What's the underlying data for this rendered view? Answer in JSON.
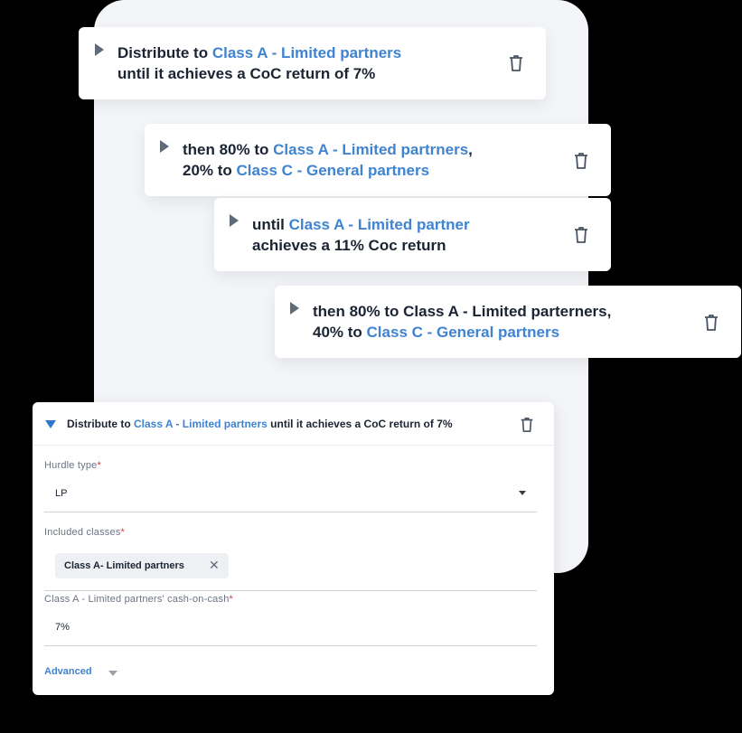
{
  "steps": [
    {
      "parts": [
        "Distribute to ",
        "Class A - Limited partners",
        "until it achieves a CoC return of 7%"
      ]
    },
    {
      "parts": [
        "then 80% to ",
        "Class A - Limited partrners",
        ",",
        "20% to ",
        "Class C - General partners"
      ]
    },
    {
      "parts": [
        "until ",
        "Class A - Limited partner",
        "achieves a 11% Coc return"
      ]
    },
    {
      "parts": [
        "then 80% to Class A - Limited parterners,",
        "40% to ",
        "Class C - General partners"
      ]
    }
  ],
  "form": {
    "header": {
      "prefix": "Distribute to ",
      "highlight": "Class A - Limited partners",
      "suffix": " until it achieves a CoC return of 7%"
    },
    "hurdle_type": {
      "label": "Hurdle type",
      "required": "*",
      "value": "LP"
    },
    "included_classes": {
      "label": "Included classes",
      "required": "*",
      "chip": "Class A- Limited partners",
      "chip_remove": "✕"
    },
    "cash_on_cash": {
      "label": "Class A - Limited partners' cash-on-cash",
      "required": "*",
      "value": "7%"
    },
    "advanced_label": "Advanced"
  },
  "icons": {
    "expand": "caret-right-icon",
    "collapse": "caret-down-icon",
    "delete": "trash-icon"
  },
  "colors": {
    "accent": "#3f83d1",
    "text": "#1b2433",
    "required": "#d23c3c"
  }
}
